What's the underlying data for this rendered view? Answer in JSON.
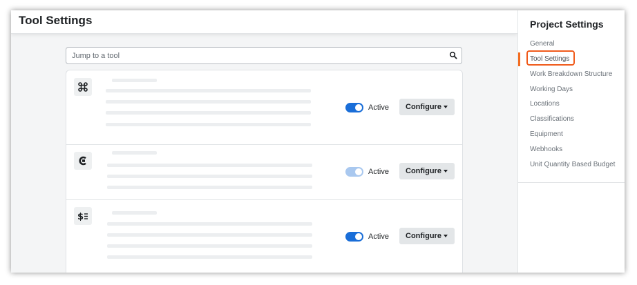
{
  "header": {
    "title": "Tool Settings"
  },
  "search": {
    "placeholder": "Jump to a tool"
  },
  "tools": [
    {
      "icon": "command-icon",
      "status_label": "Active",
      "toggle_on": true,
      "configure_label": "Configure"
    },
    {
      "icon": "c-logo-icon",
      "status_label": "Active",
      "toggle_on": true,
      "toggle_disabled": true,
      "configure_label": "Configure"
    },
    {
      "icon": "dollar-list-icon",
      "status_label": "Active",
      "toggle_on": true,
      "configure_label": "Configure"
    }
  ],
  "sidebar": {
    "title": "Project Settings",
    "items": [
      {
        "label": "General"
      },
      {
        "label": "Tool Settings",
        "selected": true
      },
      {
        "label": "Work Breakdown Structure"
      },
      {
        "label": "Working Days"
      },
      {
        "label": "Locations"
      },
      {
        "label": "Classifications"
      },
      {
        "label": "Equipment"
      },
      {
        "label": "Webhooks"
      },
      {
        "label": "Unit Quantity Based Budget"
      }
    ]
  },
  "colors": {
    "accent": "#1a6ed8",
    "highlight": "#f05a1a",
    "indicator": "#f36c1f"
  }
}
